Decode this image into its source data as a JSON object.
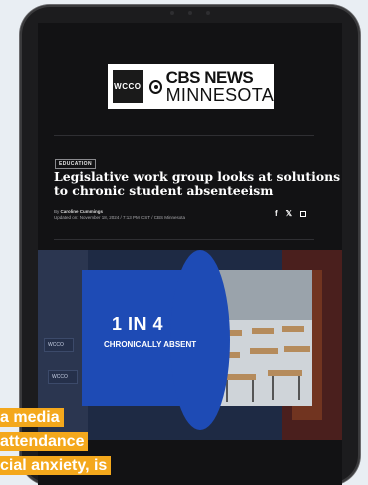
{
  "logo": {
    "station": "WCCO",
    "brand_line1": "CBS NEWS",
    "brand_line2": "MINNESOTA"
  },
  "article": {
    "category": "EDUCATION",
    "headline": "Legislative work group looks at solutions to chronic student absenteeism",
    "byline_prefix": "By",
    "author": "Caroline Cummings",
    "updated": "Updated on: November 18, 2024 / 7:13 PM CST / CBS Minnesota"
  },
  "share": {
    "facebook": "f",
    "x": "𝕏",
    "flipboard": ""
  },
  "video": {
    "stat_big": "1 IN 4",
    "stat_small": "CHRONICALLY ABSENT",
    "monitor_1": "WCCO",
    "monitor_2": "WCCO"
  },
  "caption": {
    "line1": "a media",
    "line2": "attendance",
    "line3": "cial anxiety, is"
  },
  "colors": {
    "accent": "#f4a81c",
    "panel_blue": "#1e4bb5",
    "screen_bg": "#121214"
  }
}
